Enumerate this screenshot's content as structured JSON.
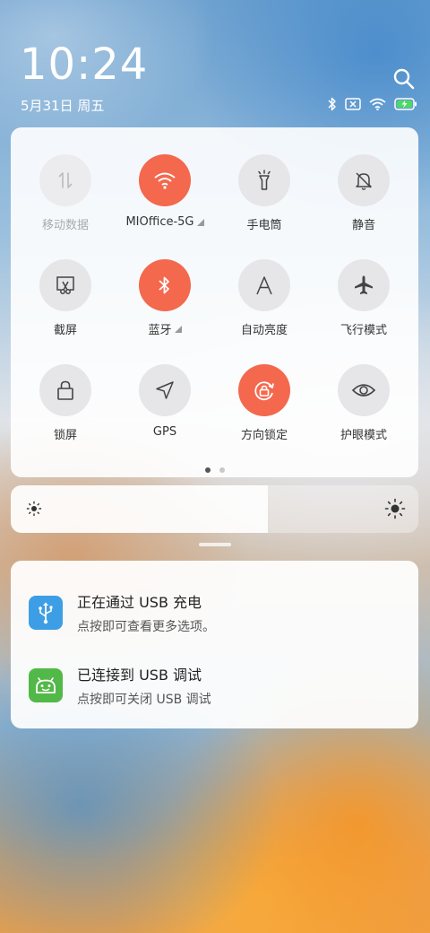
{
  "status": {
    "time": "10:24",
    "date": "5月31日 周五",
    "icons": [
      "bluetooth-icon",
      "sim-off-icon",
      "wifi-icon",
      "battery-charging-icon"
    ]
  },
  "quick_settings": {
    "tiles": [
      {
        "label": "移动数据",
        "icon": "mobile-data-icon",
        "state": "disabled"
      },
      {
        "label": "MIOffice-5G",
        "icon": "wifi-icon",
        "state": "on",
        "has_more": true
      },
      {
        "label": "手电筒",
        "icon": "flashlight-icon",
        "state": "off"
      },
      {
        "label": "静音",
        "icon": "mute-icon",
        "state": "off"
      },
      {
        "label": "截屏",
        "icon": "screenshot-icon",
        "state": "off"
      },
      {
        "label": "蓝牙",
        "icon": "bluetooth-icon",
        "state": "on",
        "has_more": true
      },
      {
        "label": "自动亮度",
        "icon": "auto-brightness-icon",
        "state": "off"
      },
      {
        "label": "飞行模式",
        "icon": "airplane-icon",
        "state": "off"
      },
      {
        "label": "锁屏",
        "icon": "lock-icon",
        "state": "off"
      },
      {
        "label": "GPS",
        "icon": "gps-icon",
        "state": "off"
      },
      {
        "label": "方向锁定",
        "icon": "rotation-lock-icon",
        "state": "on"
      },
      {
        "label": "护眼模式",
        "icon": "eye-icon",
        "state": "off"
      }
    ],
    "page_count": 2,
    "current_page": 1
  },
  "brightness": {
    "level": 0.63
  },
  "notifications": [
    {
      "title": "正在通过 USB 充电",
      "subtitle": "点按即可查看更多选项。",
      "icon": "usb-icon",
      "color": "#3d9ee5"
    },
    {
      "title": "已连接到 USB 调试",
      "subtitle": "点按即可关闭 USB 调试",
      "icon": "android-icon",
      "color": "#52b948"
    }
  ],
  "colors": {
    "active_tile": "#f4684e",
    "inactive_tile": "#e6e6e8"
  }
}
